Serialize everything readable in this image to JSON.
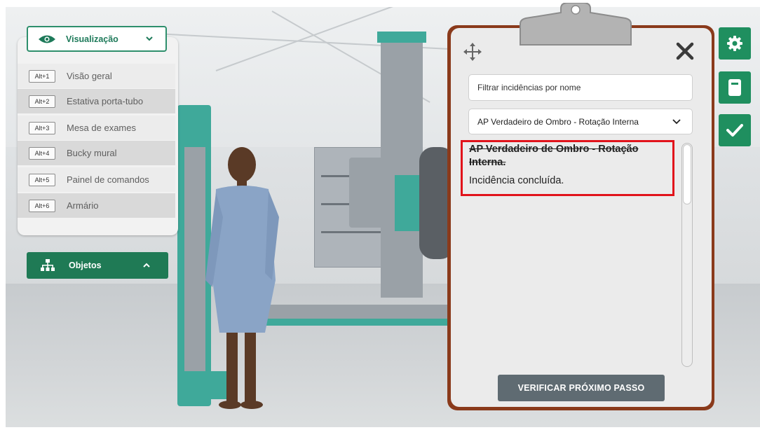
{
  "visualization": {
    "header_label": "Visualização",
    "items": [
      {
        "key": "Alt+1",
        "label": "Visão geral"
      },
      {
        "key": "Alt+2",
        "label": "Estativa porta-tubo"
      },
      {
        "key": "Alt+3",
        "label": "Mesa de exames"
      },
      {
        "key": "Alt+4",
        "label": "Bucky mural"
      },
      {
        "key": "Alt+5",
        "label": "Painel de comandos"
      },
      {
        "key": "Alt+6",
        "label": "Armário"
      }
    ]
  },
  "objects": {
    "label": "Objetos"
  },
  "clipboard": {
    "filter_placeholder": "Filtrar incidências por nome",
    "selected_incidence": "AP Verdadeiro de Ombro - Rotação Interna",
    "list": [
      {
        "title": "AP Verdadeiro de Ombro - Rotação Interna.",
        "status": "Incidência concluída."
      }
    ],
    "verify_button": "VERIFICAR PRÓXIMO PASSO"
  },
  "side_buttons": [
    "gear-icon",
    "document-icon",
    "check-icon"
  ],
  "colors": {
    "brand_green": "#1f8f5f",
    "clipboard_wood": "#8a3a1b",
    "highlight_red": "#e1131b",
    "verify_button": "#5f6b72"
  }
}
